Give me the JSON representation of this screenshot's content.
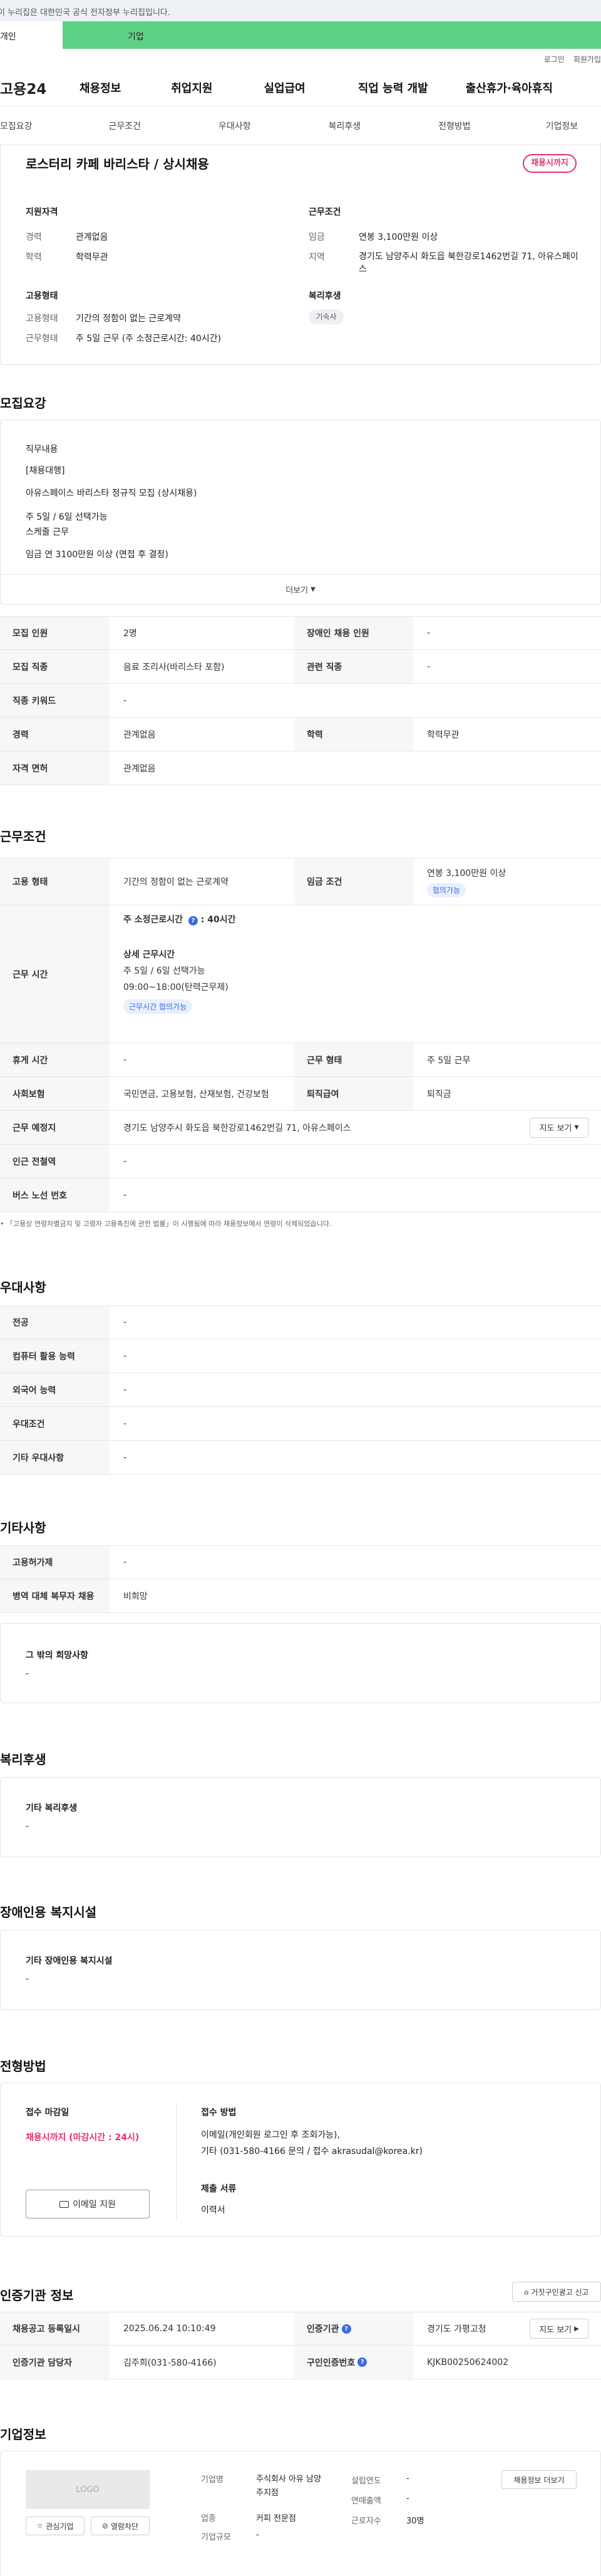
{
  "gov_banner": "이 누리집은 대한민국 공식 전자정부 누리집입니다.",
  "user_tabs": {
    "personal": "개인",
    "company": "기업"
  },
  "util": {
    "login": "로그인",
    "join": "회원가입"
  },
  "gnb": {
    "logo": "고용24",
    "menus": [
      "채용정보",
      "취업지원",
      "실업급여",
      "직업 능력 개발",
      "출산휴가·육아휴직"
    ]
  },
  "anchor_tabs": [
    "모집요강",
    "근무조건",
    "우대사항",
    "복리후생",
    "전형방법",
    "기업정보"
  ],
  "job": {
    "title": "로스터리 카페 바리스타 / 상시채용",
    "status": "채용시까지",
    "qual_title": "지원자격",
    "career_label": "경력",
    "career": "관계없음",
    "edu_label": "학력",
    "edu": "학력무관",
    "cond_title": "근무조건",
    "wage_label": "임금",
    "wage": "연봉 3,100만원 이상",
    "area_label": "지역",
    "area": "경기도 남양주시 화도읍 북한강로1462번길 71, 아유스페이스",
    "emp_title": "고용형태",
    "emptype_label": "고용형태",
    "emptype": "기간의 정함이 없는 근로계약",
    "worktype_label": "근무형태",
    "worktype": "주 5일 근무 (주 소정근로시간: 40시간)",
    "welfare_title": "복리후생",
    "welfare_chip": "기숙사"
  },
  "recruit": {
    "section_title": "모집요강",
    "duty_title": "직무내용",
    "duty_lines": [
      "[채용대행]",
      "아유스페이스 바리스타 정규직 모집 (상시채용)",
      "주 5일 / 6일 선택가능",
      "스케줄 근무",
      "임금 연 3100만원 이상 (면접 후 결정)"
    ],
    "more": "더보기",
    "rows": [
      {
        "h1": "모집 인원",
        "v1": "2명",
        "h2": "장애인 채용 인원",
        "v2": "-"
      },
      {
        "h1": "모집 직종",
        "v1": "음료 조리사(바리스타 포함)",
        "h2": "관련 직종",
        "v2": "-"
      },
      {
        "h1": "직종 키워드",
        "v1": "-"
      },
      {
        "h1": "경력",
        "v1": "관계없음",
        "h2": "학력",
        "v2": "학력무관"
      },
      {
        "h1": "자격 면허",
        "v1": "관계없음"
      }
    ]
  },
  "conditions": {
    "section_title": "근무조건",
    "emptype_h": "고용 형태",
    "emptype_v": "기간의 정함이 없는 근로계약",
    "wage_h": "임금 조건",
    "wage_v": "연봉 3,100만원 이상",
    "wage_chip": "협의가능",
    "hours_h": "근무 시간",
    "hours_total_label": "주 소정근로시간",
    "hours_total": ": 40시간",
    "hours_detail_title": "상세 근무시간",
    "hours_detail_1": "주 5일 / 6일 선택가능",
    "hours_detail_2": "09:00~18:00(탄력근무제)",
    "hours_chip": "근무시간 협의가능",
    "rest_h": "휴게 시간",
    "rest_v": "-",
    "worktype_h": "근무 형태",
    "worktype_v": "주 5일 근무",
    "insurance_h": "사회보험",
    "insurance_v": "국민연금, 고용보험, 산재보험, 건강보험",
    "severance_h": "퇴직급여",
    "severance_v": "퇴직금",
    "location_h": "근무 예정지",
    "location_v": "경기도 남양주시 화도읍 북한강로1462번길 71, 아유스페이스",
    "map_btn": "지도 보기",
    "subway_h": "인근 전철역",
    "subway_v": "-",
    "bus_h": "버스 노선 번호",
    "bus_v": "-",
    "note": "「고용상 연령차별금지 및 고령자 고용촉진에 관한 법률」이 시행됨에 따라 채용정보에서 연령이 삭제되었습니다."
  },
  "pref": {
    "section_title": "우대사항",
    "rows": [
      {
        "h": "전공",
        "v": "-"
      },
      {
        "h": "컴퓨터 활용 능력",
        "v": "-"
      },
      {
        "h": "외국어 능력",
        "v": "-"
      },
      {
        "h": "우대조건",
        "v": "-"
      },
      {
        "h": "기타 우대사항",
        "v": "-"
      }
    ]
  },
  "etc": {
    "section_title": "기타사항",
    "rows": [
      {
        "h": "고용허가제",
        "v": "-"
      },
      {
        "h": "병역 대체 복무자 채용",
        "v": "비희망"
      }
    ],
    "other_title": "그 밖의 희망사항",
    "other_value": "-"
  },
  "welfare": {
    "section_title": "복리후생",
    "box_title": "기타 복리후생",
    "box_value": "-"
  },
  "facility": {
    "section_title": "장애인용 복지시설",
    "box_title": "기타 장애인용 복지시설",
    "box_value": "-"
  },
  "selection": {
    "section_title": "전형방법",
    "deadline_title": "접수 마감일",
    "deadline": "채용시까지 (마감시간 : 24시)",
    "email_btn": "이메일 지원",
    "method_title": "접수 방법",
    "method_1": "이메일(개인회원 로그인 후 조회가능),",
    "method_2": "기타 (031-580-4166 문의 / 접수 akrasudal@korea.kr)",
    "docs_title": "제출 서류",
    "docs": "이력서"
  },
  "cert": {
    "section_title": "인증기관 정보",
    "report_btn": "거짓구인광고 신고",
    "reg_h": "채용공고 등록일시",
    "reg_v": "2025.06.24 10:10:49",
    "org_h": "인증기관",
    "org_v": "경기도 가평고청",
    "map_btn": "지도 보기",
    "mgr_h": "인증기관 담당자",
    "mgr_v": "김주희(031-580-4166)",
    "no_h": "구인인증번호",
    "no_v": "KJKB00250624002"
  },
  "company": {
    "section_title": "기업정보",
    "logo_text": "LOGO",
    "fav_btn": "관심기업",
    "block_btn": "열람차단",
    "name_label": "기업명",
    "name": "주식회사 아유 남양주지점",
    "industry_label": "업종",
    "industry": "커피 전문점",
    "scale_label": "기업규모",
    "scale": "-",
    "founded_label": "설립연도",
    "founded": "-",
    "sales_label": "연매출액",
    "sales": "-",
    "staff_label": "근로자수",
    "staff": "30명",
    "jobs_btn": "채용정보 더보기"
  }
}
